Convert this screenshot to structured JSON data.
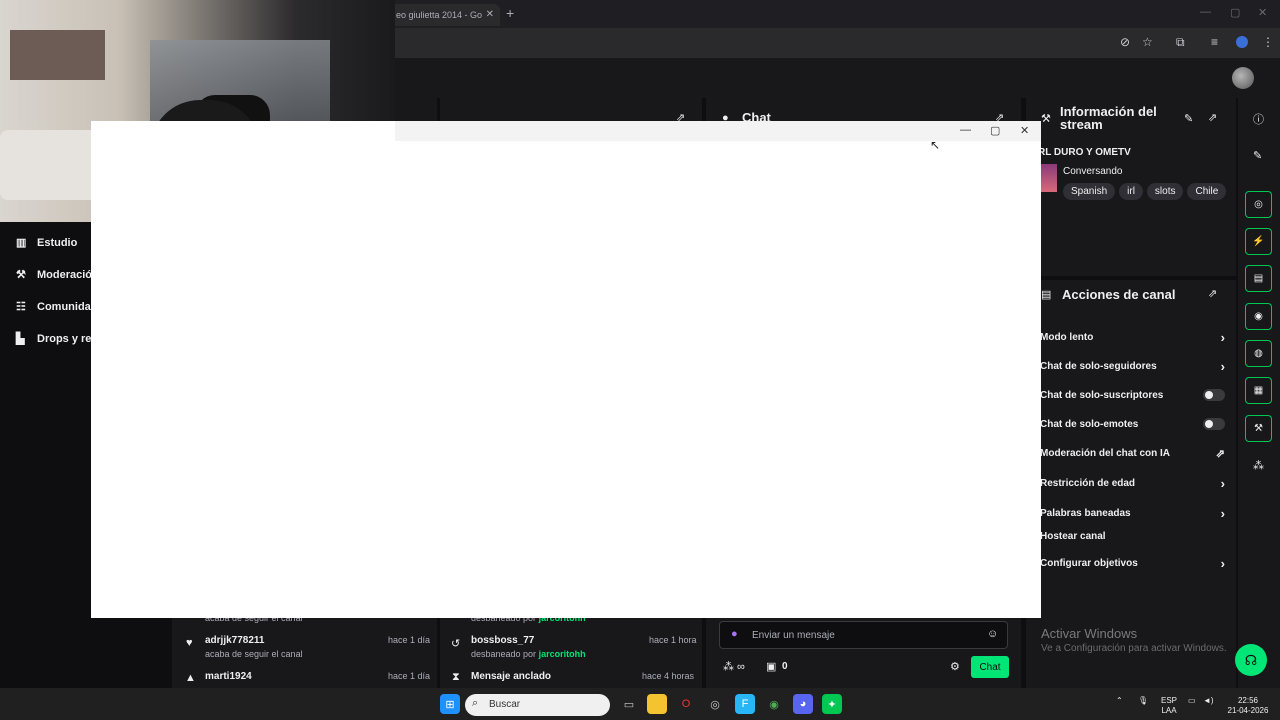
{
  "browser": {
    "tab_title": "eo giulietta 2014 - Go",
    "tab_close": "✕",
    "new_tab": "+",
    "win_min": "—",
    "win_max": "▢",
    "win_close": "✕"
  },
  "nav": {
    "items": [
      {
        "label": "Estudio",
        "icon": "studio-icon"
      },
      {
        "label": "Moderació",
        "icon": "wrench-icon"
      },
      {
        "label": "Comunida",
        "icon": "community-icon"
      },
      {
        "label": "Drops y re",
        "icon": "drops-icon"
      }
    ]
  },
  "chat_panel": {
    "title": "Chat"
  },
  "info_panel": {
    "title": "Información del stream",
    "stream_title": "RL DURO Y OMETV",
    "category": "Conversando",
    "tags": [
      "Spanish",
      "irl",
      "slots",
      "Chile"
    ]
  },
  "actions_panel": {
    "title": "Acciones de canal",
    "rows": [
      {
        "label": "Modo lento",
        "control": "chevron"
      },
      {
        "label": "Chat de solo-seguidores",
        "control": "chevron"
      },
      {
        "label": "Chat de solo-suscriptores",
        "control": "toggle"
      },
      {
        "label": "Chat de solo-emotes",
        "control": "toggle"
      },
      {
        "label": "Moderación del chat con IA",
        "control": "external"
      },
      {
        "label": "Restricción de edad",
        "control": "chevron"
      },
      {
        "label": "Palabras baneadas",
        "control": "chevron"
      },
      {
        "label": "Hostear canal",
        "control": "none"
      },
      {
        "label": "Configurar objetivos",
        "control": "chevron"
      }
    ]
  },
  "feed_left": [
    {
      "name": "",
      "sub": "acaba de seguir el canal",
      "time": ""
    },
    {
      "name": "adrjjk778211",
      "sub": "acaba de seguir el canal",
      "time": "hace 1 día"
    },
    {
      "name": "marti1924",
      "sub": "",
      "time": "hace 1 día"
    }
  ],
  "feed_mid": [
    {
      "name": "",
      "sub_prefix": "desbaneado por",
      "by": "jarcoritohh",
      "time": ""
    },
    {
      "name": "bossboss_77",
      "sub_prefix": "desbaneado por",
      "by": "jarcoritohh",
      "time": "hace 1 hora"
    },
    {
      "name": "Mensaje anclado",
      "sub_prefix": "",
      "by": "",
      "time": "hace 4 horas"
    }
  ],
  "chat_input": {
    "placeholder": "Enviar un mensaje",
    "points": "0",
    "send_label": "Chat"
  },
  "windows": {
    "activate_title": "Activar Windows",
    "activate_sub": "Ve a Configuración para activar Windows."
  },
  "taskbar": {
    "search_placeholder": "Buscar",
    "lang_top": "ESP",
    "lang_bottom": "LAA",
    "time": "22:56",
    "date": "21-04-2026"
  },
  "colors": {
    "accent": "#00e676",
    "panel": "#18181b",
    "bg": "#0e0e10"
  }
}
